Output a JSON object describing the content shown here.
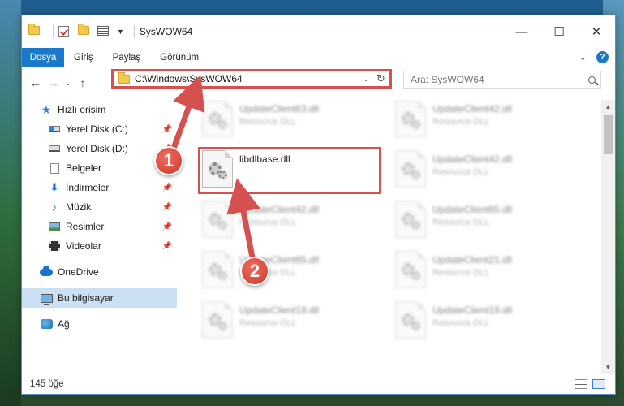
{
  "window": {
    "title": "SysWOW64"
  },
  "ribbon": {
    "tabs": [
      "Dosya",
      "Giriş",
      "Paylaş",
      "Görünüm"
    ]
  },
  "address": {
    "path": "C:\\Windows\\SysWOW64",
    "search_placeholder": "Ara: SysWOW64"
  },
  "nav": {
    "items": [
      {
        "label": "Hızlı erişim",
        "icon": "star-icon",
        "pinned": false
      },
      {
        "label": "Yerel Disk (C:)",
        "icon": "drive-icon",
        "pinned": true
      },
      {
        "label": "Yerel Disk (D:)",
        "icon": "drive-icon",
        "pinned": true
      },
      {
        "label": "Belgeler",
        "icon": "documents-icon",
        "pinned": true
      },
      {
        "label": "İndirmeler",
        "icon": "downloads-icon",
        "pinned": true
      },
      {
        "label": "Müzik",
        "icon": "music-icon",
        "pinned": true
      },
      {
        "label": "Resimler",
        "icon": "pictures-icon",
        "pinned": true
      },
      {
        "label": "Videolar",
        "icon": "videos-icon",
        "pinned": true
      },
      {
        "label": "OneDrive",
        "icon": "onedrive-icon",
        "pinned": false
      },
      {
        "label": "Bu bilgisayar",
        "icon": "this-pc-icon",
        "pinned": false,
        "selected": true
      },
      {
        "label": "Ağ",
        "icon": "network-icon",
        "pinned": false
      }
    ]
  },
  "files": {
    "left": [
      {
        "name": "UpdateClient63.dll",
        "type": "Resource DLL"
      },
      {
        "name": "libdlbase.dll",
        "type": "",
        "highlighted": true
      },
      {
        "name": "UpdateClient42.dll",
        "type": "Resource DLL"
      },
      {
        "name": "UpdateClient65.dll",
        "type": "Resource DLL"
      },
      {
        "name": "UpdateClient19.dll",
        "type": "Resource DLL"
      }
    ],
    "right": [
      {
        "name": "UpdateClient42.dll",
        "type": "Resource DLL"
      },
      {
        "name": "UpdateClient42.dll",
        "type": "Resource DLL"
      },
      {
        "name": "UpdateClient65.dll",
        "type": "Resource DLL"
      },
      {
        "name": "UpdateClient21.dll",
        "type": "Resource DLL"
      },
      {
        "name": "UpdateClient19.dll",
        "type": "Resource DLL"
      }
    ]
  },
  "status": {
    "count": "145 öğe"
  },
  "annotations": {
    "badge1": "1",
    "badge2": "2",
    "color": "#d5504e"
  }
}
